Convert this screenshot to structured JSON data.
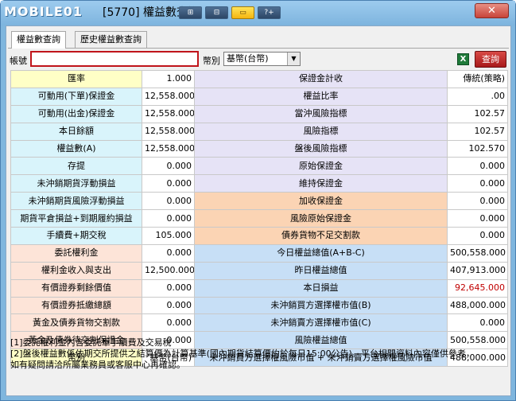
{
  "titlebar": {
    "logo_text": "MOBILE01",
    "title": "[5770] 權益數查詢",
    "buttons": [
      "⊞",
      "⊟",
      "▭",
      "?+"
    ],
    "close_label": "✕"
  },
  "tabs": [
    {
      "label": "權益數查詢"
    },
    {
      "label": "歷史權益數查詢"
    }
  ],
  "toolbar": {
    "account_label": "帳號",
    "account_value": "",
    "currency_label": "幣別",
    "currency_value": "基幣(台幣)",
    "query_label": "查詢"
  },
  "rows": [
    {
      "l1": "匯率",
      "v1": "1.000",
      "l2": "保證金計收",
      "v2": "傳統(策略)"
    },
    {
      "l1": "可動用(下單)保證金",
      "v1": "12,558.000",
      "l2": "權益比率",
      "v2": ".00"
    },
    {
      "l1": "可動用(出金)保證金",
      "v1": "12,558.000",
      "l2": "當沖風險指標",
      "v2": "102.57"
    },
    {
      "l1": "本日餘額",
      "v1": "12,558.000",
      "l2": "風險指標",
      "v2": "102.57"
    },
    {
      "l1": "權益數(A)",
      "v1": "12,558.000",
      "l2": "盤後風險指標",
      "v2": "102.570"
    },
    {
      "l1": "存提",
      "v1": "0.000",
      "l2": "原始保證金",
      "v2": "0.000"
    },
    {
      "l1": "未沖銷期貨浮動損益",
      "v1": "0.000",
      "l2": "維持保證金",
      "v2": "0.000"
    },
    {
      "l1": "未沖銷期貨風險浮動損益",
      "v1": "0.000",
      "l2": "加收保證金",
      "v2": "0.000"
    },
    {
      "l1": "期貨平倉損益+到期履約損益",
      "v1": "0.000",
      "l2": "風險原始保證金",
      "v2": "0.000"
    },
    {
      "l1": "手續費+期交稅",
      "v1": "105.000",
      "l2": "債券貨物不足交割款",
      "v2": "0.000"
    },
    {
      "l1": "委託權利金",
      "v1": "0.000",
      "l2": "今日權益總值(A+B-C)",
      "v2": "500,558.000"
    },
    {
      "l1": "權利金收入與支出",
      "v1": "12,500.000",
      "l2": "昨日權益總值",
      "v2": "407,913.000"
    },
    {
      "l1": "有價證券剩餘價值",
      "v1": "0.000",
      "l2": "本日損益",
      "v2": "92,645.000"
    },
    {
      "l1": "有價證券抵繳總額",
      "v1": "0.000",
      "l2": "未沖銷買方選擇權市值(B)",
      "v2": "488,000.000"
    },
    {
      "l1": "黃金及債券貨物交割款",
      "v1": "0.000",
      "l2": "未沖銷賣方選擇權市值(C)",
      "v2": "0.000"
    },
    {
      "l1": "黃金及債券待交割保證金",
      "v1": "0.000",
      "l2": "風險權益總值",
      "v2": "500,558.000"
    },
    {
      "l1": "幣別",
      "v1": "基幣(台幣)",
      "l2": "未沖銷買方選擇權風險市值 + 未沖銷賣方選擇權風險市值",
      "v2": "488,000.000"
    }
  ],
  "notes": [
    "[1]委託權利金內含委託單手續費及交易稅",
    "[2]盤後權益數係依期交所提供之結算價為計算基準(國內期貨結算價約於每日15:00公告)。平台相關資料內容僅供參考，",
    "如有疑問請洽所屬業務員或客服中心再確認。"
  ],
  "colors": {
    "titlebar": "#7db4de",
    "query_button": "#c0141a",
    "loss_text": "#c00000"
  }
}
